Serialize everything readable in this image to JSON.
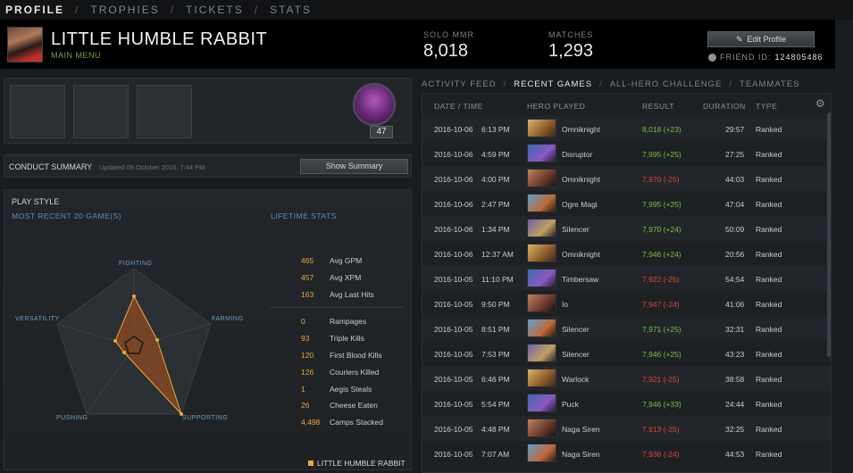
{
  "nav": {
    "items": [
      "PROFILE",
      "TROPHIES",
      "TICKETS",
      "STATS"
    ],
    "separator": "/"
  },
  "header": {
    "player_name": "LITTLE HUMBLE RABBIT",
    "main_menu": "MAIN MENU",
    "solo_mmr_label": "SOLO MMR",
    "solo_mmr": "8,018",
    "matches_label": "MATCHES",
    "matches": "1,293",
    "edit_profile": "Edit Profile",
    "friend_id_label": "FRIEND ID:",
    "friend_id": "124805486"
  },
  "trophies": {
    "hero_level": "47"
  },
  "conduct": {
    "title": "CONDUCT SUMMARY",
    "updated": "Updated 05 October 2016, 7:44 PM",
    "button": "Show Summary"
  },
  "playstyle": {
    "title": "PLAY STYLE",
    "subtitle": "MOST RECENT 20 GAME(S)",
    "lifetime": "LIFETIME STATS",
    "axes": [
      "FIGHTING",
      "FARMING",
      "SUPPORTING",
      "PUSHING",
      "VERSATILITY"
    ],
    "legend": "LITTLE HUMBLE RABBIT",
    "stats_top": [
      {
        "value": "465",
        "name": "Avg GPM"
      },
      {
        "value": "457",
        "name": "Avg XPM"
      },
      {
        "value": "163",
        "name": "Avg Last Hits"
      }
    ],
    "stats_bottom": [
      {
        "value": "0",
        "name": "Rampages"
      },
      {
        "value": "93",
        "name": "Triple Kills"
      },
      {
        "value": "120",
        "name": "First Blood Kills"
      },
      {
        "value": "126",
        "name": "Couriers Killed"
      },
      {
        "value": "1",
        "name": "Aegis Steals"
      },
      {
        "value": "26",
        "name": "Cheese Eaten"
      },
      {
        "value": "4,498",
        "name": "Camps Stacked"
      }
    ]
  },
  "tabs": [
    "ACTIVITY FEED",
    "RECENT GAMES",
    "ALL-HERO CHALLENGE",
    "TEAMMATES"
  ],
  "games": {
    "headers": {
      "date": "DATE / TIME",
      "hero": "HERO PLAYED",
      "result": "RESULT",
      "duration": "DURATION",
      "type": "TYPE"
    },
    "rows": [
      {
        "date": "2016-10-06",
        "time": "6:13 PM",
        "hero": "Omniknight",
        "result": "8,018 (+23)",
        "win": true,
        "duration": "29:57",
        "type": "Ranked"
      },
      {
        "date": "2016-10-06",
        "time": "4:59 PM",
        "hero": "Disruptor",
        "result": "7,995 (+25)",
        "win": true,
        "duration": "27:25",
        "type": "Ranked"
      },
      {
        "date": "2016-10-06",
        "time": "4:00 PM",
        "hero": "Omniknight",
        "result": "7,970 (-25)",
        "win": false,
        "duration": "44:03",
        "type": "Ranked"
      },
      {
        "date": "2016-10-06",
        "time": "2:47 PM",
        "hero": "Ogre Magi",
        "result": "7,995 (+25)",
        "win": true,
        "duration": "47:04",
        "type": "Ranked"
      },
      {
        "date": "2016-10-06",
        "time": "1:34 PM",
        "hero": "Silencer",
        "result": "7,970 (+24)",
        "win": true,
        "duration": "50:09",
        "type": "Ranked"
      },
      {
        "date": "2016-10-06",
        "time": "12:37 AM",
        "hero": "Omniknight",
        "result": "7,946 (+24)",
        "win": true,
        "duration": "20:56",
        "type": "Ranked"
      },
      {
        "date": "2016-10-05",
        "time": "11:10 PM",
        "hero": "Timbersaw",
        "result": "7,922 (-25)",
        "win": false,
        "duration": "54:54",
        "type": "Ranked"
      },
      {
        "date": "2016-10-05",
        "time": "9:50 PM",
        "hero": "Io",
        "result": "7,947 (-24)",
        "win": false,
        "duration": "41:06",
        "type": "Ranked"
      },
      {
        "date": "2016-10-05",
        "time": "8:51 PM",
        "hero": "Silencer",
        "result": "7,971 (+25)",
        "win": true,
        "duration": "32:31",
        "type": "Ranked"
      },
      {
        "date": "2016-10-05",
        "time": "7:53 PM",
        "hero": "Silencer",
        "result": "7,946 (+25)",
        "win": true,
        "duration": "43:23",
        "type": "Ranked"
      },
      {
        "date": "2016-10-05",
        "time": "6:46 PM",
        "hero": "Warlock",
        "result": "7,921 (-25)",
        "win": false,
        "duration": "38:58",
        "type": "Ranked"
      },
      {
        "date": "2016-10-05",
        "time": "5:54 PM",
        "hero": "Puck",
        "result": "7,946 (+33)",
        "win": true,
        "duration": "24:44",
        "type": "Ranked"
      },
      {
        "date": "2016-10-05",
        "time": "4:48 PM",
        "hero": "Naga Siren",
        "result": "7,913 (-25)",
        "win": false,
        "duration": "32:25",
        "type": "Ranked"
      },
      {
        "date": "2016-10-05",
        "time": "7:07 AM",
        "hero": "Naga Siren",
        "result": "7,938 (-24)",
        "win": false,
        "duration": "44:53",
        "type": "Ranked"
      }
    ]
  },
  "colors": {
    "accent": "#f0a63a",
    "win": "#7bc043",
    "loss": "#e0463a",
    "link": "#5f8fb0"
  }
}
